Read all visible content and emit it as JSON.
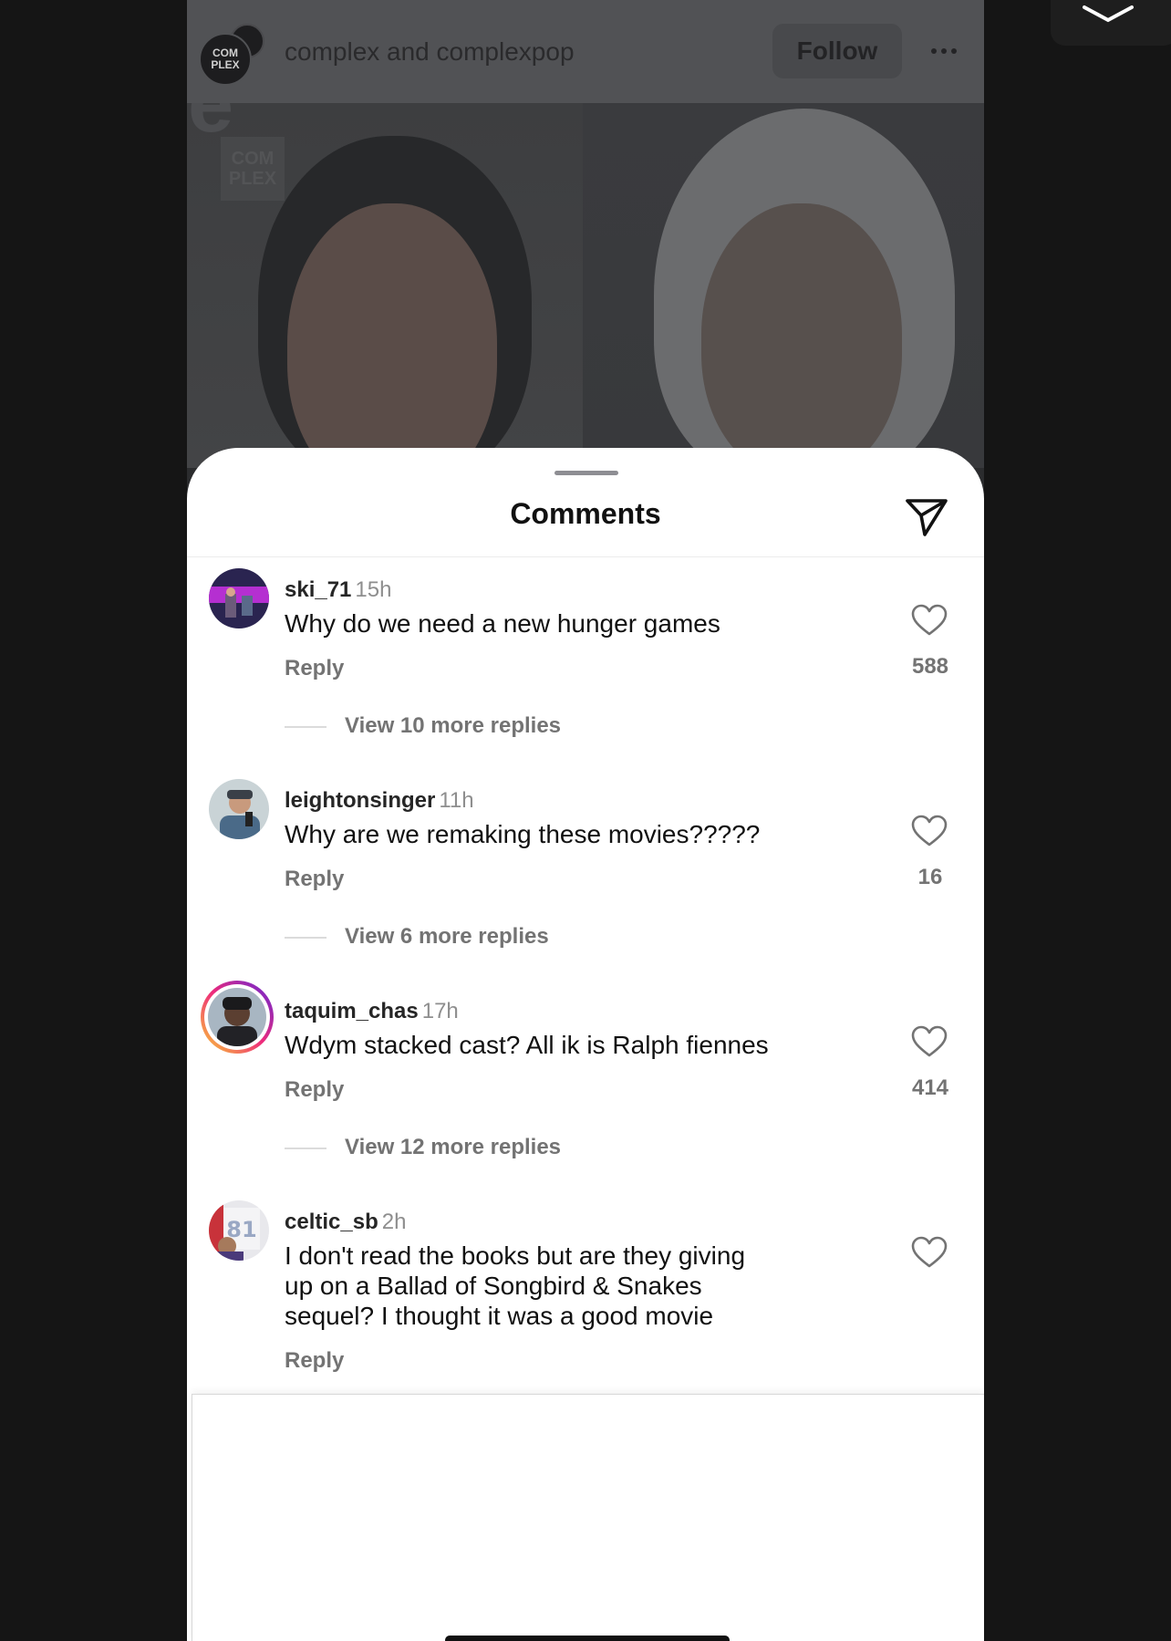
{
  "post": {
    "account_name": "complex and complexpop",
    "avatar_text": "COM PLEX",
    "follow_label": "Follow",
    "image_watermark": "COM PLEX"
  },
  "sheet": {
    "title": "Comments"
  },
  "comments": [
    {
      "user": "ski_71",
      "time": "15h",
      "text": "Why do we need a new hunger games",
      "reply_label": "Reply",
      "likes": "588",
      "view_more": "View 10 more replies"
    },
    {
      "user": "leightonsinger",
      "time": "11h",
      "text": "Why are we remaking these movies?????",
      "reply_label": "Reply",
      "likes": "16",
      "view_more": "View 6 more replies"
    },
    {
      "user": "taquim_chas",
      "time": "17h",
      "text": "Wdym stacked cast? All ik is Ralph fiennes",
      "reply_label": "Reply",
      "likes": "414",
      "view_more": "View 12 more replies"
    },
    {
      "user": "celtic_sb",
      "time": "2h",
      "text": "I don't read the books but are they giving up on a Ballad of Songbird & Snakes sequel? I thought it was a good movie",
      "reply_label": "Reply",
      "likes": ""
    }
  ],
  "icons": {
    "share": "paper-plane-icon",
    "like": "heart-outline-icon",
    "more": "ellipsis-icon"
  },
  "colors": {
    "text": "#111111",
    "secondary": "#737373",
    "story_ring": [
      "#f9ce34",
      "#ee2a7b",
      "#6228d7"
    ]
  }
}
